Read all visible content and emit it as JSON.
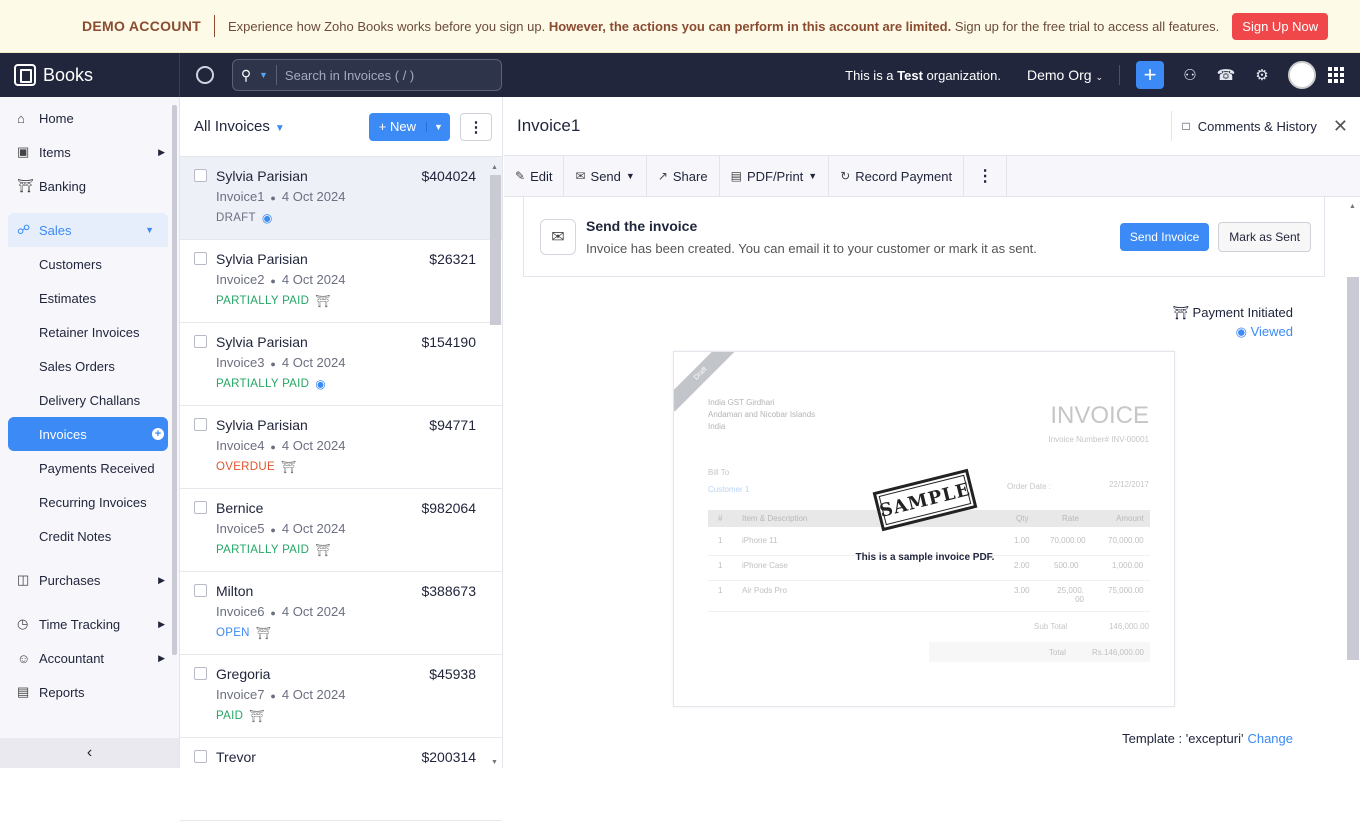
{
  "banner": {
    "label": "DEMO ACCOUNT",
    "msg_normal": "Experience how Zoho Books works before you sign up. ",
    "msg_bold": "However, the actions you can perform in this account are limited.",
    "msg_end": " Sign up for the free trial to access all features.",
    "signup": "Sign Up Now"
  },
  "topbar": {
    "brand": "Books",
    "search_placeholder": "Search in Invoices ( / )",
    "org_note_pre": "This is a ",
    "org_note_bold": "Test",
    "org_note_post": " organization.",
    "org_name": "Demo Org"
  },
  "sidebar": {
    "home": "Home",
    "items": "Items",
    "banking": "Banking",
    "sales": "Sales",
    "sales_items": [
      "Customers",
      "Estimates",
      "Retainer Invoices",
      "Sales Orders",
      "Delivery Challans",
      "Invoices",
      "Payments Received",
      "Recurring Invoices",
      "Credit Notes"
    ],
    "purchases": "Purchases",
    "time_tracking": "Time Tracking",
    "accountant": "Accountant",
    "reports": "Reports"
  },
  "list": {
    "title": "All Invoices",
    "new_label": "New",
    "invoices": [
      {
        "customer": "Sylvia Parisian",
        "amount": "$404024",
        "number": "Invoice1",
        "date": "4 Oct 2024",
        "status": "DRAFT",
        "status_class": "draft",
        "icon": "eye-icon"
      },
      {
        "customer": "Sylvia Parisian",
        "amount": "$26321",
        "number": "Invoice2",
        "date": "4 Oct 2024",
        "status": "PARTIALLY PAID",
        "status_class": "pp",
        "icon": "bank-icon"
      },
      {
        "customer": "Sylvia Parisian",
        "amount": "$154190",
        "number": "Invoice3",
        "date": "4 Oct 2024",
        "status": "PARTIALLY PAID",
        "status_class": "pp",
        "icon": "eye-icon"
      },
      {
        "customer": "Sylvia Parisian",
        "amount": "$94771",
        "number": "Invoice4",
        "date": "4 Oct 2024",
        "status": "OVERDUE",
        "status_class": "overdue",
        "icon": "bank-icon"
      },
      {
        "customer": "Bernice",
        "amount": "$982064",
        "number": "Invoice5",
        "date": "4 Oct 2024",
        "status": "PARTIALLY PAID",
        "status_class": "pp",
        "icon": "bank-icon"
      },
      {
        "customer": "Milton",
        "amount": "$388673",
        "number": "Invoice6",
        "date": "4 Oct 2024",
        "status": "OPEN",
        "status_class": "open",
        "icon": "bank-icon"
      },
      {
        "customer": "Gregoria",
        "amount": "$45938",
        "number": "Invoice7",
        "date": "4 Oct 2024",
        "status": "PAID",
        "status_class": "paid",
        "icon": "bank-icon"
      },
      {
        "customer": "Trevor",
        "amount": "$200314",
        "number": "",
        "date": "",
        "status": "",
        "status_class": "",
        "icon": ""
      }
    ]
  },
  "detail": {
    "title": "Invoice1",
    "comments": "Comments & History",
    "toolbar": {
      "edit": "Edit",
      "send": "Send",
      "share": "Share",
      "pdf": "PDF/Print",
      "record": "Record Payment"
    },
    "send_card": {
      "heading": "Send the invoice",
      "text": "Invoice has been created. You can email it to your customer or mark it as sent.",
      "send_btn": "Send Invoice",
      "mark_btn": "Mark as Sent"
    },
    "payment_initiated": "Payment Initiated",
    "viewed": "Viewed",
    "preview": {
      "ribbon": "Draft",
      "org_name": "India GST Girdhari",
      "org_addr1": "Andaman and Nicobar Islands",
      "org_addr2": "India",
      "doc_title": "INVOICE",
      "number": "Invoice Number# INV-00001",
      "bill_to": "Bill To",
      "bill_customer": "Customer 1",
      "order_date_label": "Order Date :",
      "order_date": "22/12/2017",
      "cols": [
        "#",
        "Item & Description",
        "Qty",
        "Rate",
        "Amount"
      ],
      "rows": [
        [
          "1",
          "iPhone 11",
          "1.00",
          "70,000.00",
          "70,000.00"
        ],
        [
          "1",
          "iPhone Case",
          "2.00",
          "500.00",
          "1,000.00"
        ],
        [
          "1",
          "Air Pods Pro",
          "3.00",
          "25,000.00",
          "75,000.00"
        ]
      ],
      "subtotal_label": "Sub Total",
      "subtotal": "146,000.00",
      "total_label": "Total",
      "total": "Rs.146,000.00",
      "stamp": "SAMPLE",
      "sample_text": "This is a sample invoice PDF."
    },
    "template_label": "Template : 'excepturi'",
    "change": "Change"
  }
}
